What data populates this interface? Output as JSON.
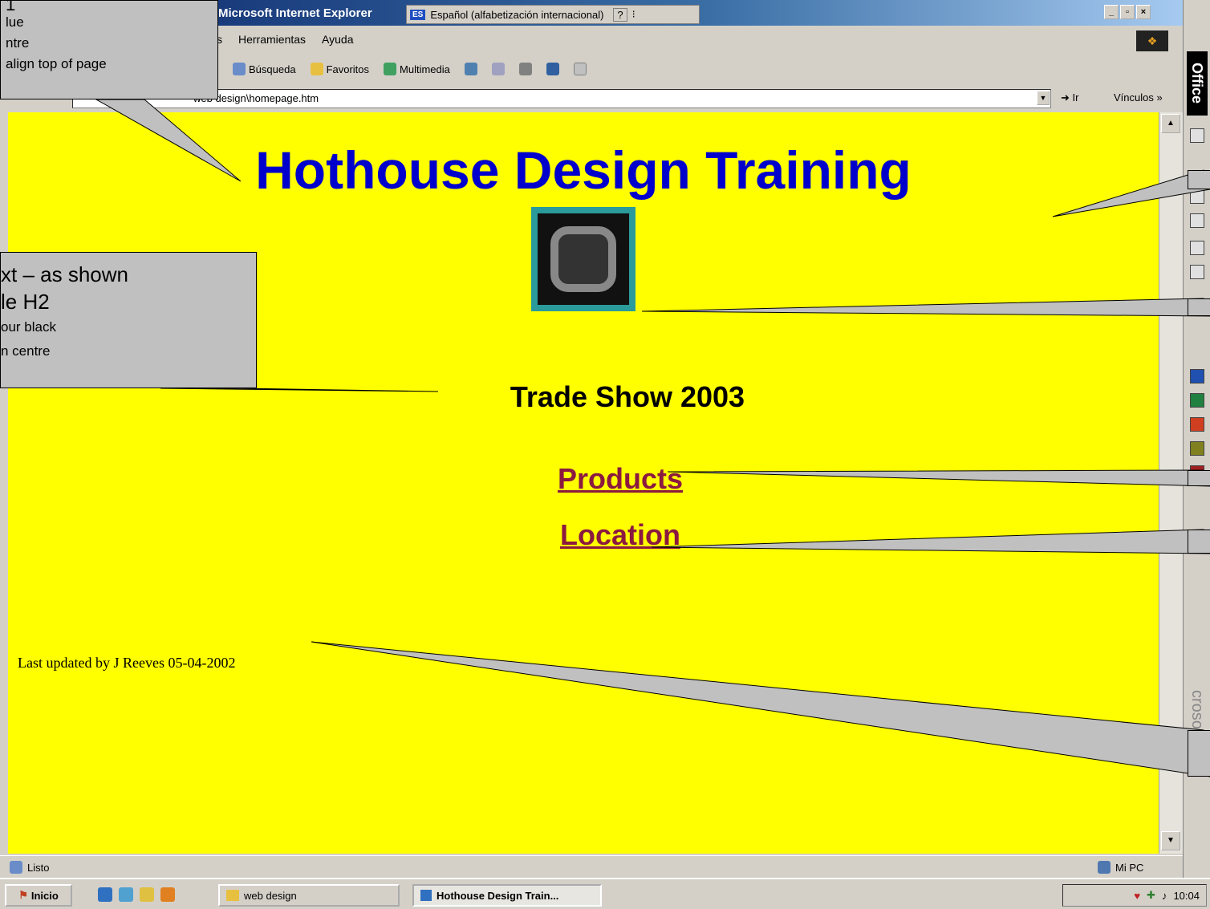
{
  "window": {
    "title": "Microsoft Internet Explorer",
    "language_bar": {
      "code": "ES",
      "text": "Español (alfabetización internacional)",
      "help": "?"
    }
  },
  "menu": {
    "items": [
      "s",
      "Herramientas",
      "Ayuda"
    ]
  },
  "toolbar": {
    "items": [
      "Búsqueda",
      "Favoritos",
      "Multimedia"
    ]
  },
  "address": {
    "value": "web design\\homepage.htm",
    "go_label": "Ir",
    "links_label": "Vínculos »"
  },
  "page": {
    "heading": "Hothouse Design Training",
    "subheading": "Trade Show 2003",
    "links": [
      "Products",
      "Location"
    ],
    "footer": "Last updated by J Reeves 05-04-2002"
  },
  "status": {
    "left": "Listo",
    "zone": "Mi PC"
  },
  "taskbar": {
    "start": "Inicio",
    "tasks": [
      "web design",
      "Hothouse Design Train..."
    ],
    "clock": "10:04"
  },
  "office_bar": {
    "label": "Office",
    "brand": "crosoft"
  },
  "callouts": {
    "h1": {
      "line1": "1",
      "line2": "lue",
      "line3": "ntre",
      "line4": "align top of page"
    },
    "h2": {
      "line1": "xt – as shown",
      "line2": "le H2",
      "line3": "our black",
      "line4": "n centre"
    }
  },
  "colors": {
    "background": "#ffff00",
    "heading": "#0000cc",
    "link": "#8b1a40",
    "callout": "#c0c0c0"
  }
}
